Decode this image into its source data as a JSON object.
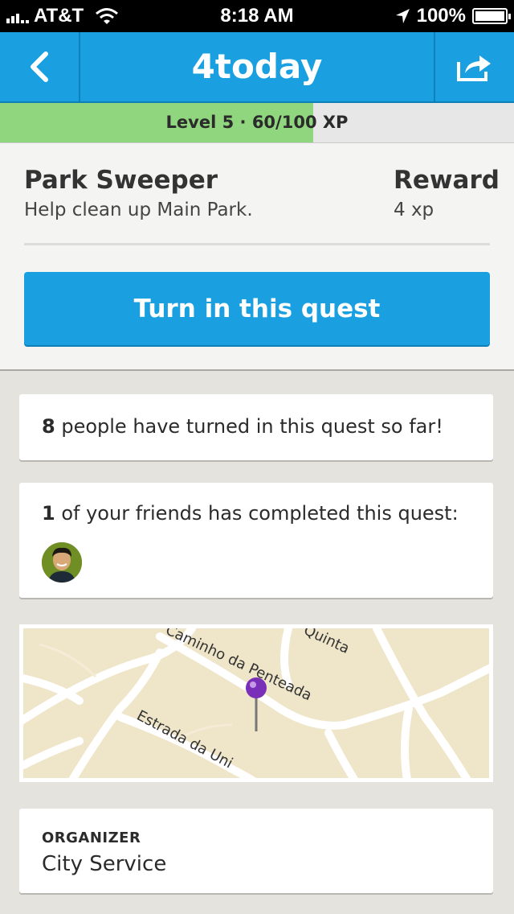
{
  "status_bar": {
    "carrier": "AT&T",
    "time": "8:18 AM",
    "battery": "100%"
  },
  "nav": {
    "title": "4today",
    "back_icon": "chevron-left-icon",
    "share_icon": "share-icon"
  },
  "xp": {
    "label": "Level 5 · 60/100 XP",
    "progress": 0.61
  },
  "quest": {
    "title": "Park Sweeper",
    "description": "Help clean up Main Park.",
    "reward_label": "Reward",
    "reward_value": "4 xp",
    "button_label": "Turn in this quest"
  },
  "stats": {
    "count": "8",
    "count_text": " people have turned in this quest so far!"
  },
  "friends": {
    "count": "1",
    "text": " of your friends has completed this quest:"
  },
  "map": {
    "street_1": "Caminho da Penteada",
    "street_2": "Estrada da Uni",
    "street_3": "Quinta"
  },
  "organizer": {
    "label": "ORGANIZER",
    "value": "City Service"
  },
  "colors": {
    "brand": "#1aa0e0",
    "xp_fill": "#8fd67f",
    "background": "#e4e3de"
  }
}
